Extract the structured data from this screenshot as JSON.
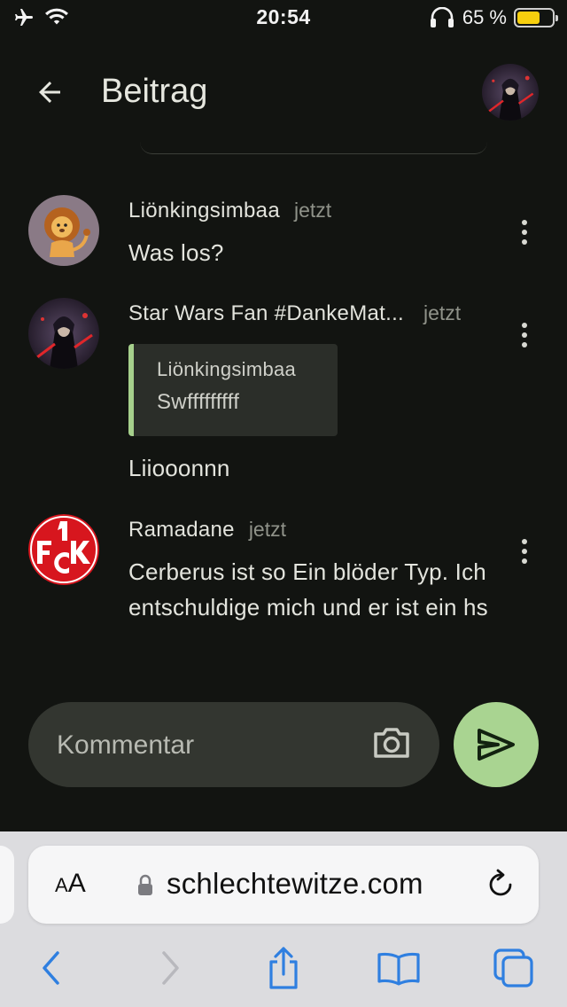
{
  "status_bar": {
    "time": "20:54",
    "battery_percent": "65 %",
    "battery_level": 0.65,
    "icons": [
      "airplane-icon",
      "wifi-icon",
      "headphones-icon",
      "battery-icon"
    ]
  },
  "app_bar": {
    "title": "Beitrag",
    "back_icon": "arrow-left-icon",
    "avatar": "user-avatar"
  },
  "comments": [
    {
      "author": "Liönkingsimbaa",
      "time": "jetzt",
      "text": "Was los?",
      "avatar": "lion-avatar"
    },
    {
      "author": "Star Wars Fan #DankeMat...",
      "time": "jetzt",
      "quote": {
        "author": "Liönkingsimbaa",
        "text": "Swfffffffff"
      },
      "text": "Liiooonnn",
      "avatar": "sith-avatar"
    },
    {
      "author": "Ramadane",
      "time": "jetzt",
      "text": "Cerberus ist so Ein blöder Typ. Ich entschuldige mich und er ist ein hs",
      "avatar": "fck-logo-avatar"
    }
  ],
  "composer": {
    "placeholder": "Kommentar",
    "camera_icon": "camera-icon",
    "send_icon": "send-icon"
  },
  "browser": {
    "aa_small": "A",
    "aa_big": "A",
    "url": "schlechtewitze.com",
    "icons": [
      "lock-icon",
      "reload-icon",
      "back-icon",
      "forward-icon",
      "share-icon",
      "bookmarks-icon",
      "tabs-icon"
    ]
  },
  "colors": {
    "background": "#121411",
    "accent_green": "#a9d491",
    "quote_bar": "#a6d08c",
    "browser_blue": "#2f7fe0"
  }
}
